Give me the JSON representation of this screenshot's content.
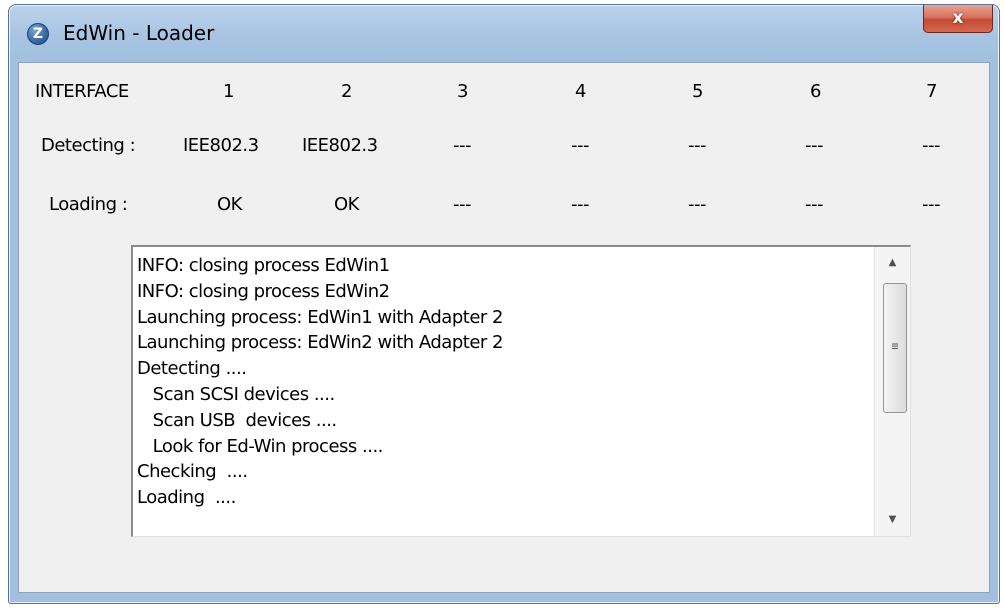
{
  "window": {
    "title": "EdWin - Loader",
    "app_icon": "edwin-z-logo",
    "app_icon_glyph": "Z",
    "close_icon": "close-icon",
    "close_glyph": "x"
  },
  "header": {
    "interface_label": "INTERFACE",
    "columns": [
      "1",
      "2",
      "3",
      "4",
      "5",
      "6",
      "7"
    ]
  },
  "detecting": {
    "label": "Detecting :",
    "values": [
      "IEE802.3",
      "IEE802.3",
      "---",
      "---",
      "---",
      "---",
      "---"
    ]
  },
  "loading": {
    "label": "Loading :",
    "values": [
      "OK",
      "OK",
      "---",
      "---",
      "---",
      "---",
      "---"
    ]
  },
  "log": {
    "lines": [
      "INFO: closing process EdWin1",
      "INFO: closing process EdWin2",
      "Launching process: EdWin1 with Adapter 2",
      "Launching process: EdWin2 with Adapter 2",
      "Detecting ....",
      "   Scan SCSI devices ....",
      "   Scan USB  devices ....",
      "   Look for Ed-Win process ....",
      "Checking  ....",
      "Loading  ...."
    ],
    "scroll_up_glyph": "▲",
    "scroll_down_glyph": "▼",
    "grip_glyph": "≡"
  },
  "colors": {
    "titlebar": "#a9c4e3",
    "close_button": "#c9503a",
    "client_bg": "#f0f0f0"
  }
}
